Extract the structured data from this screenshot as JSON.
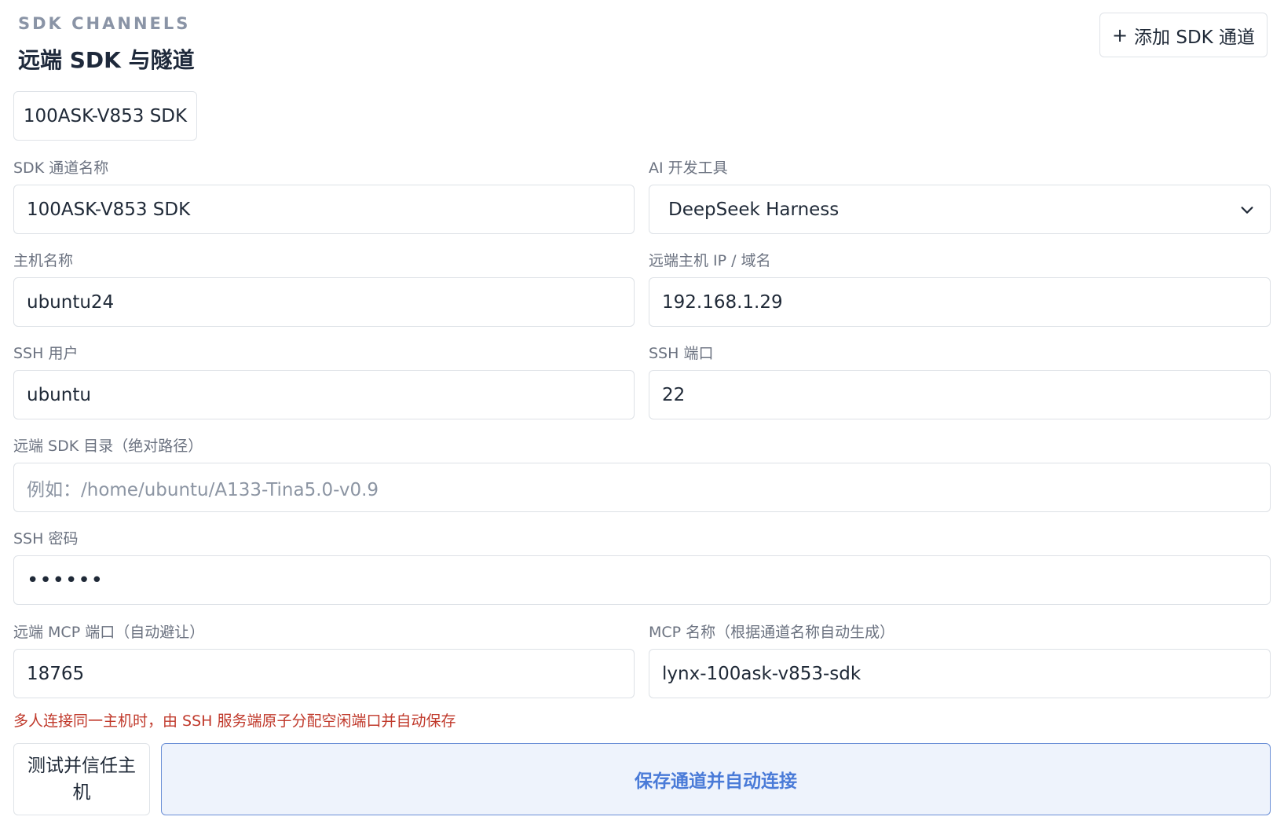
{
  "header": {
    "eyebrow": "SDK CHANNELS",
    "title": "远端 SDK 与隧道",
    "add_button_plus": "+",
    "add_button_label": "添加 SDK 通道"
  },
  "tabs": [
    {
      "label": "100ASK-V853 SDK"
    }
  ],
  "form": {
    "channel_name": {
      "label": "SDK 通道名称",
      "value": "100ASK-V853 SDK"
    },
    "ai_tool": {
      "label": "AI 开发工具",
      "value": "DeepSeek Harness",
      "icon": "chevron-down-icon"
    },
    "hostname": {
      "label": "主机名称",
      "value": "ubuntu24"
    },
    "remote_ip": {
      "label": "远端主机 IP / 域名",
      "value": "192.168.1.29"
    },
    "ssh_user": {
      "label": "SSH 用户",
      "value": "ubuntu"
    },
    "ssh_port": {
      "label": "SSH 端口",
      "value": "22"
    },
    "sdk_dir": {
      "label": "远端 SDK 目录（绝对路径）",
      "placeholder": "例如：/home/ubuntu/A133-Tina5.0-v0.9",
      "value": ""
    },
    "ssh_password": {
      "label": "SSH 密码",
      "value": "••••••"
    },
    "mcp_port": {
      "label": "远端 MCP 端口（自动避让）",
      "value": "18765"
    },
    "mcp_name": {
      "label": "MCP 名称（根据通道名称自动生成）",
      "value": "lynx-100ask-v853-sdk"
    },
    "hint": "多人连接同一主机时，由 SSH 服务端原子分配空闲端口并自动保存"
  },
  "actions": {
    "test_label": "测试并信任主机",
    "save_label": "保存通道并自动连接"
  },
  "colors": {
    "accent": "#4a7bd8",
    "accent_bg": "#eef3fc",
    "hint": "#c0392b",
    "muted": "#6b7280"
  }
}
